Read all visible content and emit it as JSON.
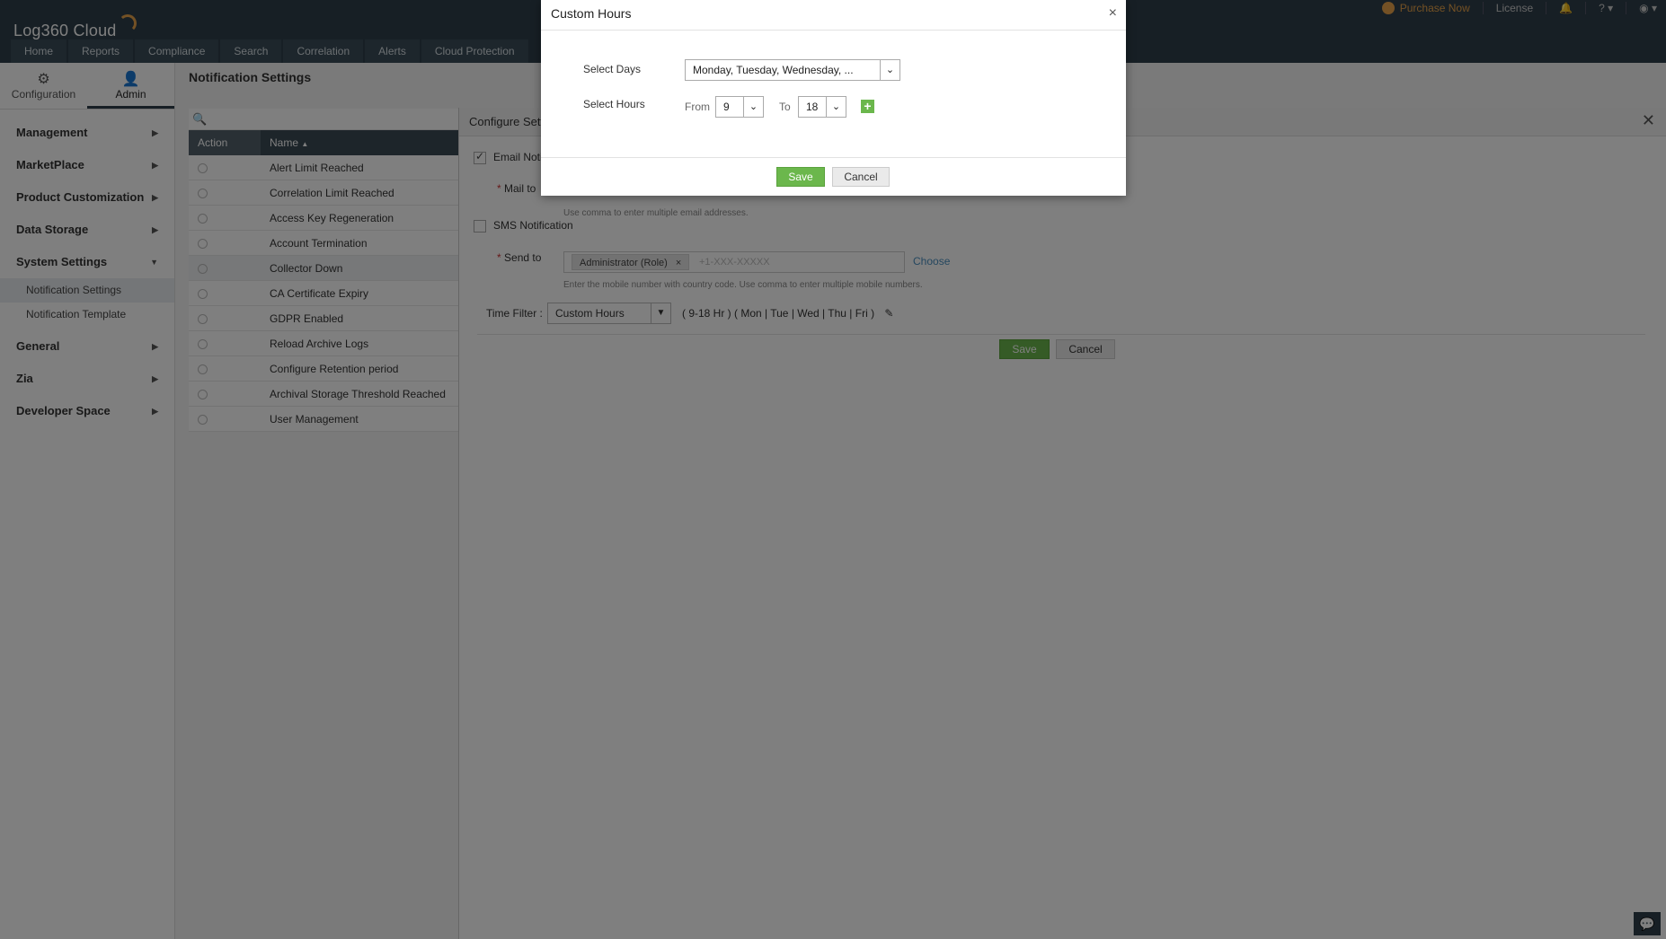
{
  "app": {
    "logo": "Log360 Cloud",
    "purchase_now": "Purchase Now",
    "license": "License",
    "help": "?"
  },
  "nav": {
    "tabs": [
      "Home",
      "Reports",
      "Compliance",
      "Search",
      "Correlation",
      "Alerts",
      "Cloud Protection"
    ]
  },
  "sidebar": {
    "tabs": [
      {
        "label": "Configuration",
        "icon": "gear-icon"
      },
      {
        "label": "Admin",
        "icon": "user-icon"
      }
    ],
    "items": {
      "management": "Management",
      "marketplace": "MarketPlace",
      "product_customization": "Product Customization",
      "data_storage": "Data Storage",
      "system_settings": "System Settings",
      "notification_settings": "Notification Settings",
      "notification_template": "Notification Template",
      "general": "General",
      "zia": "Zia",
      "developer_space": "Developer Space"
    }
  },
  "main": {
    "title": "Notification Settings",
    "table": {
      "col_action": "Action",
      "col_name": "Name",
      "rows": [
        "Alert Limit Reached",
        "Correlation Limit Reached",
        "Access Key Regeneration",
        "Account Termination",
        "Collector Down",
        "CA Certificate Expiry",
        "GDPR Enabled",
        "Reload Archive Logs",
        "Configure Retention period",
        "Archival Storage Threshold Reached",
        "User Management"
      ]
    }
  },
  "config": {
    "title": "Configure Setti",
    "email_notification": "Email Notif",
    "mail_to": "Mail to",
    "mail_hint": "Use comma to enter multiple email addresses.",
    "sms_notification": "SMS Notification",
    "send_to": "Send to",
    "send_tag": "Administrator (Role)",
    "send_placeholder": "+1-XXX-XXXXX",
    "choose": "Choose",
    "sms_hint": "Enter the mobile number with country code. Use comma to enter multiple mobile numbers.",
    "time_filter_label": "Time Filter :",
    "time_filter_value": "Custom Hours",
    "time_filter_summary": "( 9-18 Hr ) ( Mon | Tue | Wed | Thu | Fri )",
    "save": "Save",
    "cancel": "Cancel"
  },
  "modal": {
    "title": "Custom Hours",
    "close": "×",
    "select_days_label": "Select Days",
    "select_days_value": "Monday, Tuesday, Wednesday, ...",
    "select_hours_label": "Select Hours",
    "from_label": "From",
    "from_value": "9",
    "to_label": "To",
    "to_value": "18",
    "save": "Save",
    "cancel": "Cancel"
  },
  "colors": {
    "header_bg": "#2f3f4a",
    "accent_green": "#6bb74c",
    "purchase_orange": "#e8a24a"
  }
}
